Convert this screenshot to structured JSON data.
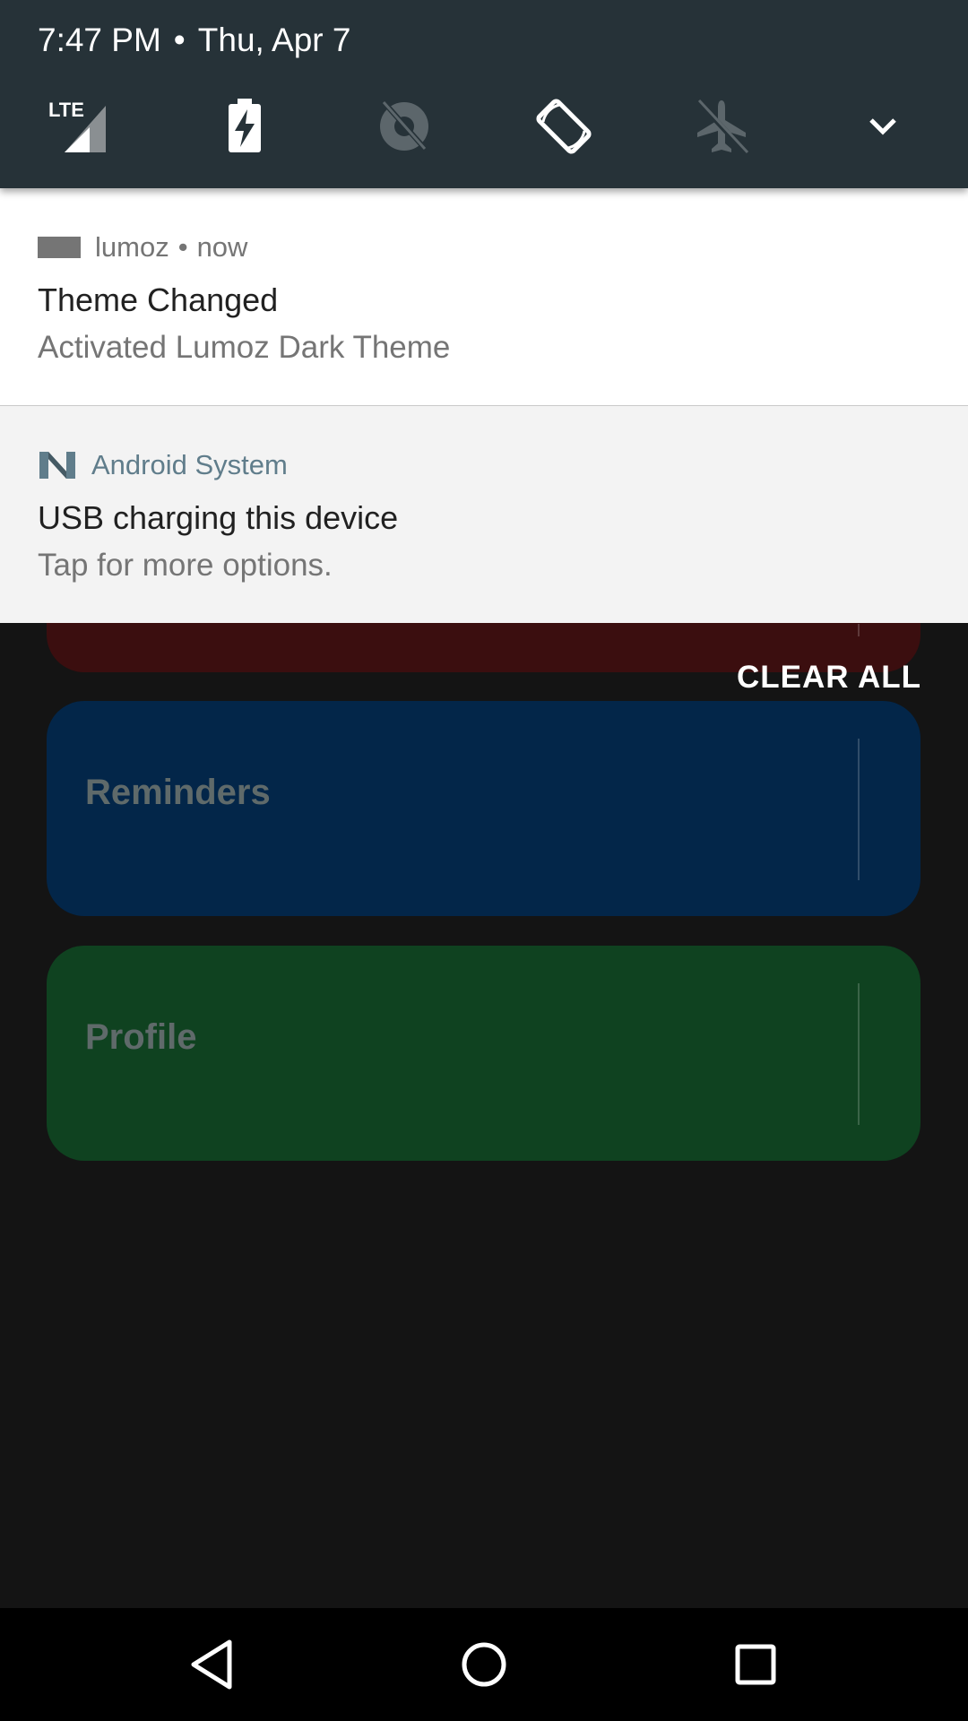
{
  "status": {
    "time": "7:47 PM",
    "separator": "•",
    "date": "Thu, Apr 7",
    "lte_label": "LTE"
  },
  "quick_settings": [
    {
      "name": "cellular-lte-icon",
      "state": "on"
    },
    {
      "name": "battery-charging-icon",
      "state": "on"
    },
    {
      "name": "data-saver-off-icon",
      "state": "off"
    },
    {
      "name": "auto-rotate-icon",
      "state": "on"
    },
    {
      "name": "airplane-mode-icon",
      "state": "off"
    },
    {
      "name": "expand-chevron-icon",
      "state": "on"
    }
  ],
  "notifications": [
    {
      "app": "lumoz",
      "separator": "•",
      "time": "now",
      "title": "Theme Changed",
      "text": "Activated Lumoz Dark Theme"
    },
    {
      "app": "Android System",
      "title": "USB charging this device",
      "text": "Tap for more options."
    }
  ],
  "clear_all_label": "CLEAR ALL",
  "cards": [
    {
      "title": "",
      "color": "#3b0e0f"
    },
    {
      "title": "Reminders",
      "color": "#032649"
    },
    {
      "title": "Profile",
      "color": "#0f4220"
    }
  ],
  "colors": {
    "header_bg": "#263238",
    "android_system_accent": "#607d8b",
    "background": "#141414"
  }
}
